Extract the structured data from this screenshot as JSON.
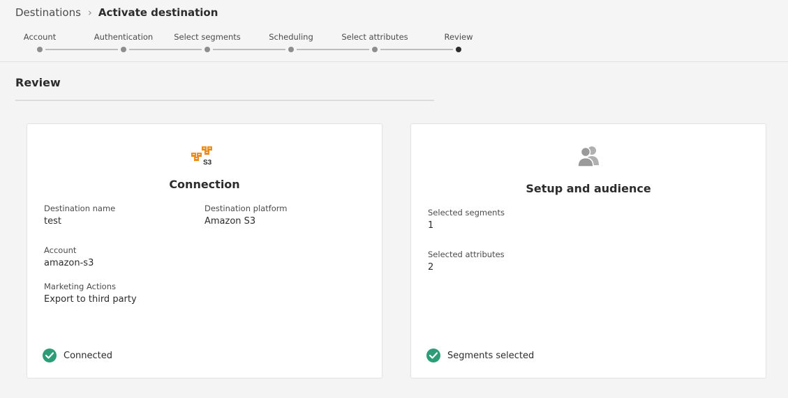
{
  "breadcrumb": {
    "parent": "Destinations",
    "current": "Activate destination"
  },
  "steps": [
    {
      "label": "Account"
    },
    {
      "label": "Authentication"
    },
    {
      "label": "Select segments"
    },
    {
      "label": "Scheduling"
    },
    {
      "label": "Select attributes"
    },
    {
      "label": "Review"
    }
  ],
  "section": {
    "title": "Review"
  },
  "connection_card": {
    "icon": "amazon-s3-icon",
    "icon_text": "S3",
    "title": "Connection",
    "destination_name_label": "Destination name",
    "destination_name_value": "test",
    "destination_platform_label": "Destination platform",
    "destination_platform_value": "Amazon S3",
    "account_label": "Account",
    "account_value": "amazon-s3",
    "marketing_actions_label": "Marketing Actions",
    "marketing_actions_value": "Export to third party",
    "status": "Connected"
  },
  "audience_card": {
    "icon": "users-icon",
    "title": "Setup and audience",
    "selected_segments_label": "Selected segments",
    "selected_segments_value": "1",
    "selected_attributes_label": "Selected attributes",
    "selected_attributes_value": "2",
    "status": "Segments selected"
  },
  "colors": {
    "success": "#2d9d78",
    "s3_orange": "#f08c1e",
    "current_step": "#2c2c2c",
    "step_dot": "#8e8e8e"
  }
}
